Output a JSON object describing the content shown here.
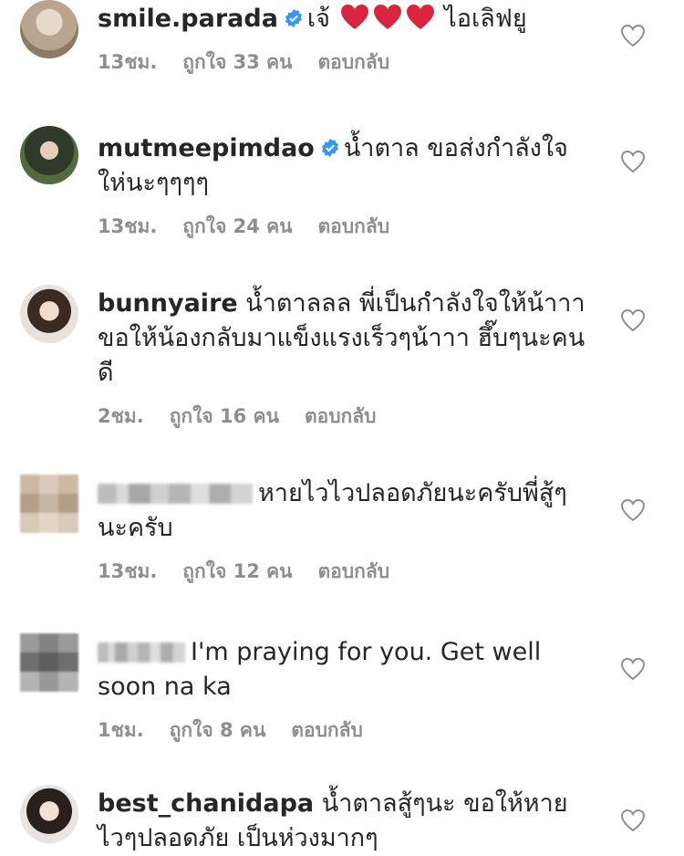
{
  "comments": [
    {
      "username": "smile.parada",
      "verified": true,
      "text_before": "เจ้",
      "hearts": 3,
      "text_after": "ไอเลิฟยู",
      "time": "13ชม.",
      "likes": "ถูกใจ 33 คน",
      "reply": "ตอบกลับ"
    },
    {
      "username": "mutmeepimdao",
      "verified": true,
      "text": "น้ำตาล ขอส่งกำลังใจให่นะๆๆๆๆ",
      "time": "13ชม.",
      "likes": "ถูกใจ 24 คน",
      "reply": "ตอบกลับ"
    },
    {
      "username": "bunnyaire",
      "verified": false,
      "text": "น้ำตาลลล พี่เป็นกำลังใจให้น้าาาขอให้น้องกลับมาแข็งแรงเร็วๆน้าาา ฮึ๊บๆนะคนดี",
      "time": "2ชม.",
      "likes": "ถูกใจ 16 คน",
      "reply": "ตอบกลับ"
    },
    {
      "username": "",
      "verified": false,
      "text": "หายไวไวปลอดภัยนะครับพี่สู้ๆนะครับ",
      "time": "13ชม.",
      "likes": "ถูกใจ 12 คน",
      "reply": "ตอบกลับ"
    },
    {
      "username": "",
      "verified": false,
      "text": "I'm praying for you. Get well soon na ka",
      "time": "1ชม.",
      "likes": "ถูกใจ 8 คน",
      "reply": "ตอบกลับ"
    },
    {
      "username": "best_chanidapa",
      "verified": false,
      "text": "น้ำตาลสู้ๆนะ ขอให้หายไวๆปลอดภัย เป็นห่วงมากๆ"
    }
  ],
  "colors": {
    "text": "#262626",
    "meta": "#8e8e8e",
    "verified": "#3897f0",
    "heart_emoji": "#d7263d"
  },
  "icons": {
    "like": "heart-outline-icon",
    "verified": "verified-badge-icon",
    "emoji": "red-heart-emoji"
  }
}
